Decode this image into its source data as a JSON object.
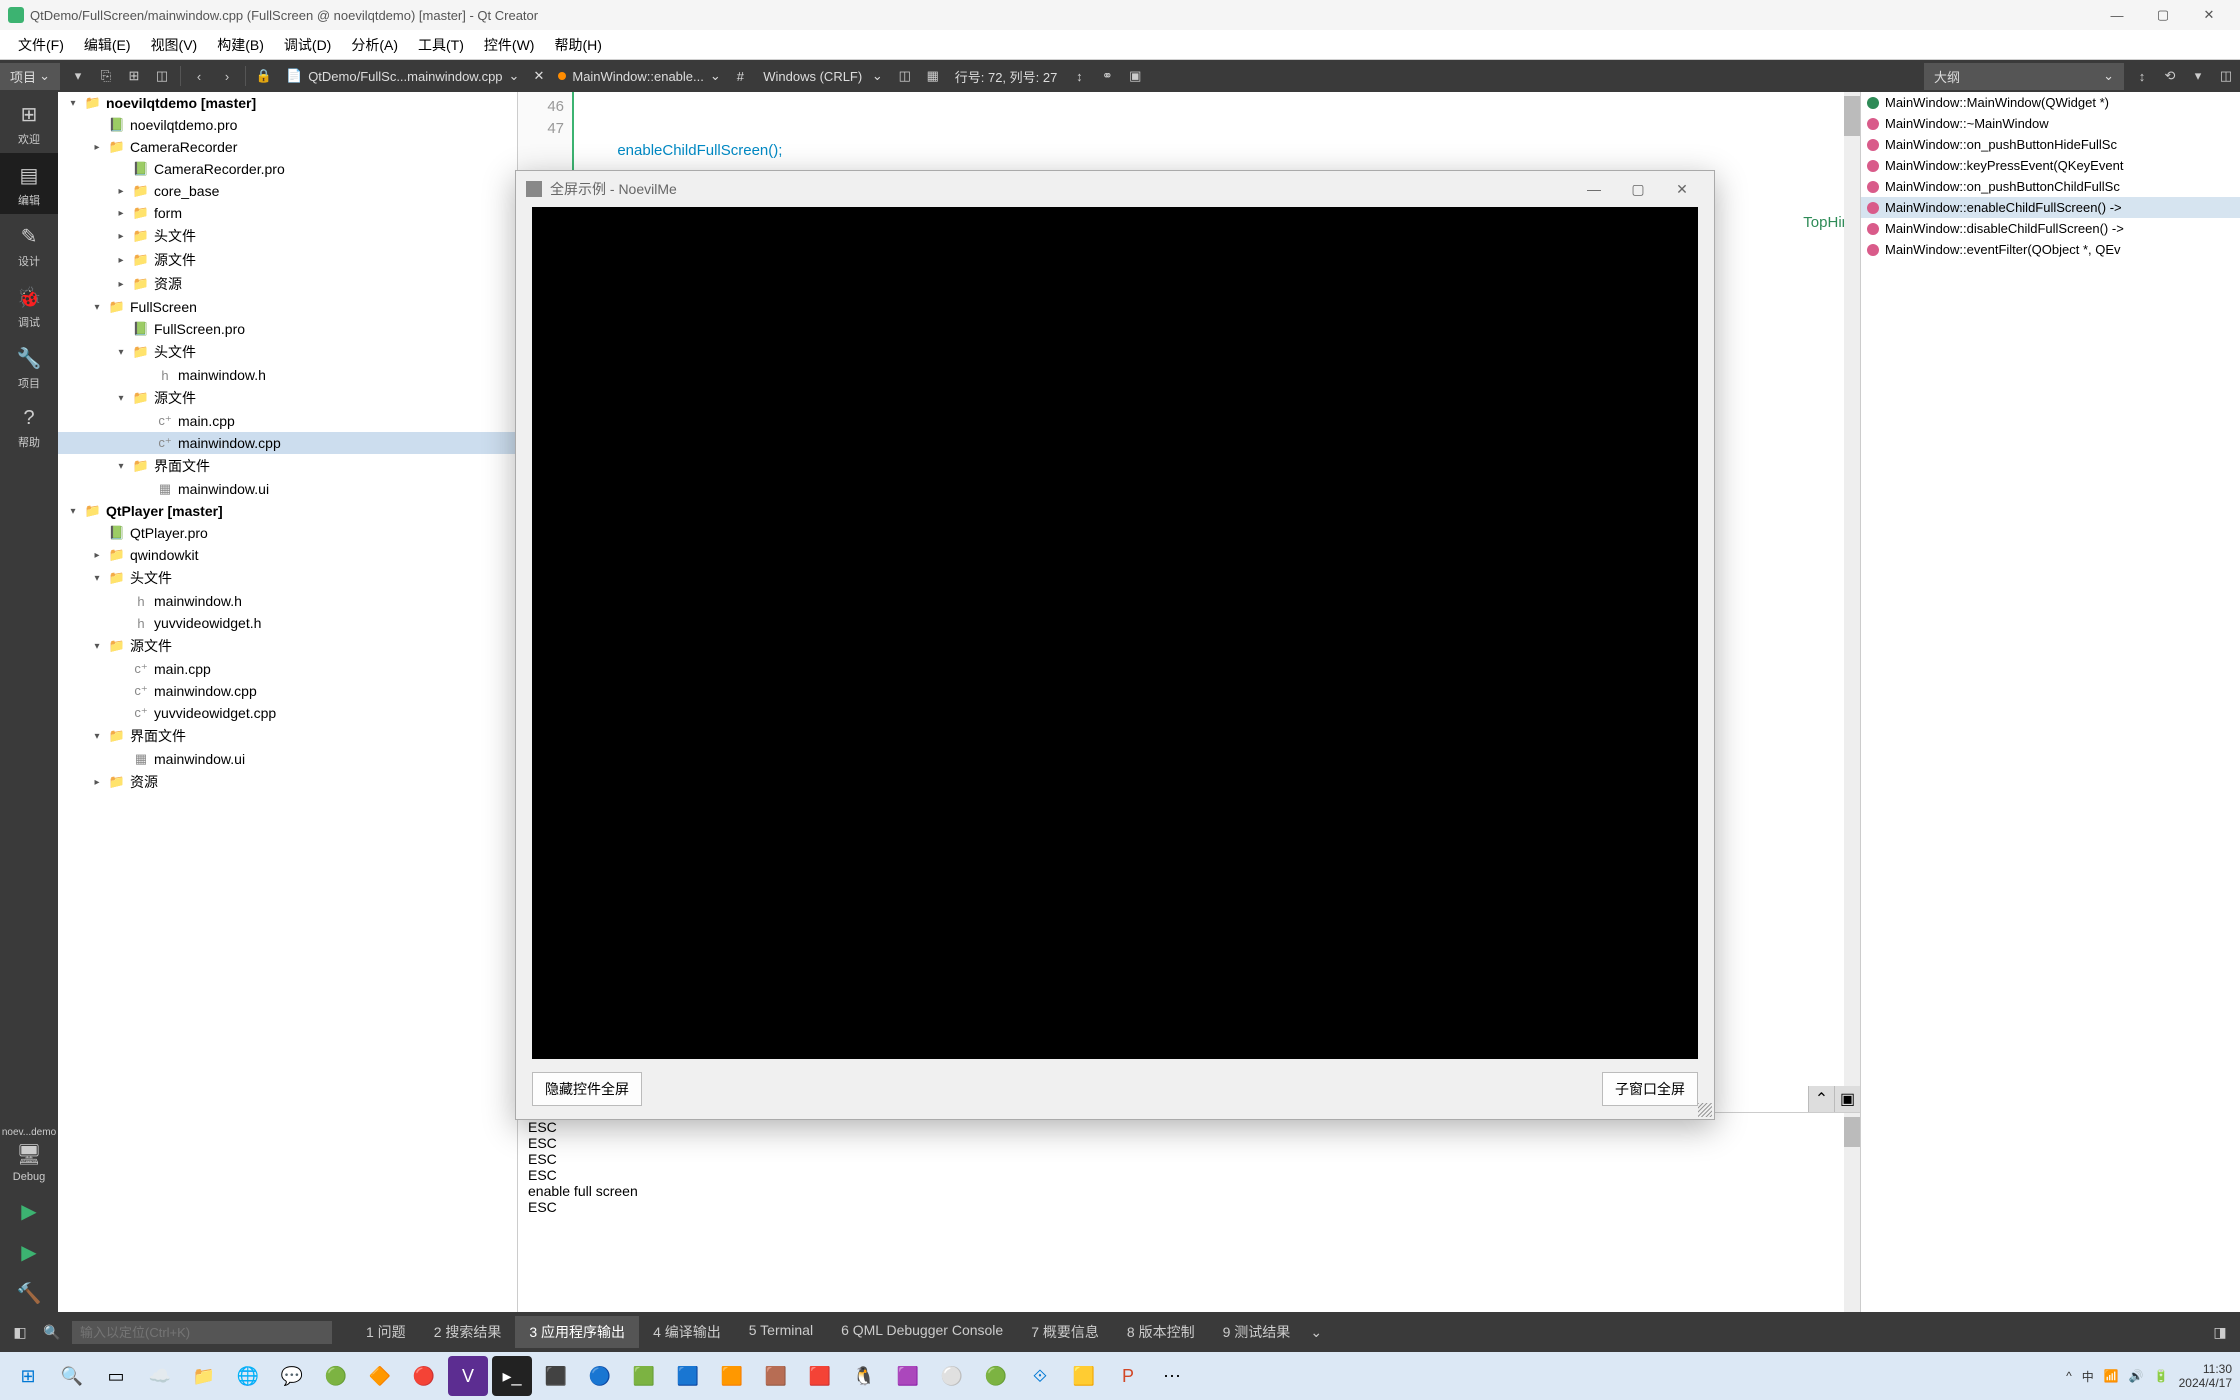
{
  "titlebar": {
    "title": "QtDemo/FullScreen/mainwindow.cpp (FullScreen @ noevilqtdemo) [master] - Qt Creator"
  },
  "menubar": {
    "items": [
      "文件(F)",
      "编辑(E)",
      "视图(V)",
      "构建(B)",
      "调试(D)",
      "分析(A)",
      "工具(T)",
      "控件(W)",
      "帮助(H)"
    ]
  },
  "toolbar": {
    "project_selector": "项目",
    "breadcrumb_file": "QtDemo/FullSc...mainwindow.cpp",
    "breadcrumb_symbol": "MainWindow::enable...",
    "line_encoding": "Windows (CRLF)",
    "cursor_info": "行号: 72, 列号: 27",
    "outline_label": "大纲"
  },
  "activity": {
    "items": [
      {
        "label": "欢迎",
        "glyph": "⊞"
      },
      {
        "label": "编辑",
        "glyph": "▤",
        "active": true
      },
      {
        "label": "设计",
        "glyph": "✎"
      },
      {
        "label": "调试",
        "glyph": "🐞"
      },
      {
        "label": "项目",
        "glyph": "🔧"
      },
      {
        "label": "帮助",
        "glyph": "?"
      }
    ],
    "target_label": "noev...demo",
    "target_config": "Debug"
  },
  "project_tree": {
    "rows": [
      {
        "indent": 0,
        "arrow": "▾",
        "icon": "folder",
        "label": "noevilqtdemo [master]",
        "bold": true
      },
      {
        "indent": 1,
        "arrow": "",
        "icon": "pro",
        "label": "noevilqtdemo.pro"
      },
      {
        "indent": 1,
        "arrow": "▸",
        "icon": "folder",
        "label": "CameraRecorder"
      },
      {
        "indent": 2,
        "arrow": "",
        "icon": "pro",
        "label": "CameraRecorder.pro"
      },
      {
        "indent": 2,
        "arrow": "▸",
        "icon": "folder",
        "label": "core_base"
      },
      {
        "indent": 2,
        "arrow": "▸",
        "icon": "folder",
        "label": "form"
      },
      {
        "indent": 2,
        "arrow": "▸",
        "icon": "folder",
        "label": "头文件"
      },
      {
        "indent": 2,
        "arrow": "▸",
        "icon": "folder",
        "label": "源文件"
      },
      {
        "indent": 2,
        "arrow": "▸",
        "icon": "folder",
        "label": "资源"
      },
      {
        "indent": 1,
        "arrow": "▾",
        "icon": "folder",
        "label": "FullScreen"
      },
      {
        "indent": 2,
        "arrow": "",
        "icon": "pro",
        "label": "FullScreen.pro"
      },
      {
        "indent": 2,
        "arrow": "▾",
        "icon": "folder",
        "label": "头文件"
      },
      {
        "indent": 3,
        "arrow": "",
        "icon": "h",
        "label": "mainwindow.h"
      },
      {
        "indent": 2,
        "arrow": "▾",
        "icon": "folder",
        "label": "源文件"
      },
      {
        "indent": 3,
        "arrow": "",
        "icon": "cpp",
        "label": "main.cpp"
      },
      {
        "indent": 3,
        "arrow": "",
        "icon": "cpp",
        "label": "mainwindow.cpp",
        "selected": true
      },
      {
        "indent": 2,
        "arrow": "▾",
        "icon": "folder",
        "label": "界面文件"
      },
      {
        "indent": 3,
        "arrow": "",
        "icon": "ui",
        "label": "mainwindow.ui"
      },
      {
        "indent": 0,
        "arrow": "▾",
        "icon": "folder",
        "label": "QtPlayer [master]",
        "bold": true
      },
      {
        "indent": 1,
        "arrow": "",
        "icon": "pro",
        "label": "QtPlayer.pro"
      },
      {
        "indent": 1,
        "arrow": "▸",
        "icon": "folder",
        "label": "qwindowkit"
      },
      {
        "indent": 1,
        "arrow": "▾",
        "icon": "folder",
        "label": "头文件"
      },
      {
        "indent": 2,
        "arrow": "",
        "icon": "h",
        "label": "mainwindow.h"
      },
      {
        "indent": 2,
        "arrow": "",
        "icon": "h",
        "label": "yuvvideowidget.h"
      },
      {
        "indent": 1,
        "arrow": "▾",
        "icon": "folder",
        "label": "源文件"
      },
      {
        "indent": 2,
        "arrow": "",
        "icon": "cpp",
        "label": "main.cpp"
      },
      {
        "indent": 2,
        "arrow": "",
        "icon": "cpp",
        "label": "mainwindow.cpp"
      },
      {
        "indent": 2,
        "arrow": "",
        "icon": "cpp",
        "label": "yuvvideowidget.cpp"
      },
      {
        "indent": 1,
        "arrow": "▾",
        "icon": "folder",
        "label": "界面文件"
      },
      {
        "indent": 2,
        "arrow": "",
        "icon": "ui",
        "label": "mainwindow.ui"
      },
      {
        "indent": 1,
        "arrow": "▸",
        "icon": "folder",
        "label": "资源"
      }
    ]
  },
  "editor": {
    "lines": [
      "46",
      "47"
    ],
    "code_line_46": "        enableChildFullScreen();",
    "snippet_right": "TopHin"
  },
  "output": {
    "lines": [
      "ESC",
      "ESC",
      "ESC",
      "ESC",
      "enable full screen",
      "ESC"
    ]
  },
  "outline": {
    "items": [
      {
        "color": "#2e8b57",
        "label": "MainWindow::MainWindow(QWidget *)"
      },
      {
        "color": "#d95b8a",
        "label": "MainWindow::~MainWindow"
      },
      {
        "color": "#d95b8a",
        "label": "MainWindow::on_pushButtonHideFullSc"
      },
      {
        "color": "#d95b8a",
        "label": "MainWindow::keyPressEvent(QKeyEvent"
      },
      {
        "color": "#d95b8a",
        "label": "MainWindow::on_pushButtonChildFullSc"
      },
      {
        "color": "#d95b8a",
        "label": "MainWindow::enableChildFullScreen() ->",
        "sel": true
      },
      {
        "color": "#d95b8a",
        "label": "MainWindow::disableChildFullScreen() ->"
      },
      {
        "color": "#d95b8a",
        "label": "MainWindow::eventFilter(QObject *, QEv"
      }
    ]
  },
  "status": {
    "search_placeholder": "输入以定位(Ctrl+K)",
    "tabs": [
      "1  问题",
      "2  搜索结果",
      "3  应用程序输出",
      "4  编译输出",
      "5  Terminal",
      "6  QML Debugger Console",
      "7  概要信息",
      "8  版本控制",
      "9  测试结果"
    ]
  },
  "float_window": {
    "title": "全屏示例 - NoevilMe",
    "btn_left": "隐藏控件全屏",
    "btn_right": "子窗口全屏"
  },
  "taskbar": {
    "time": "11:30",
    "date": "2024/4/17"
  }
}
